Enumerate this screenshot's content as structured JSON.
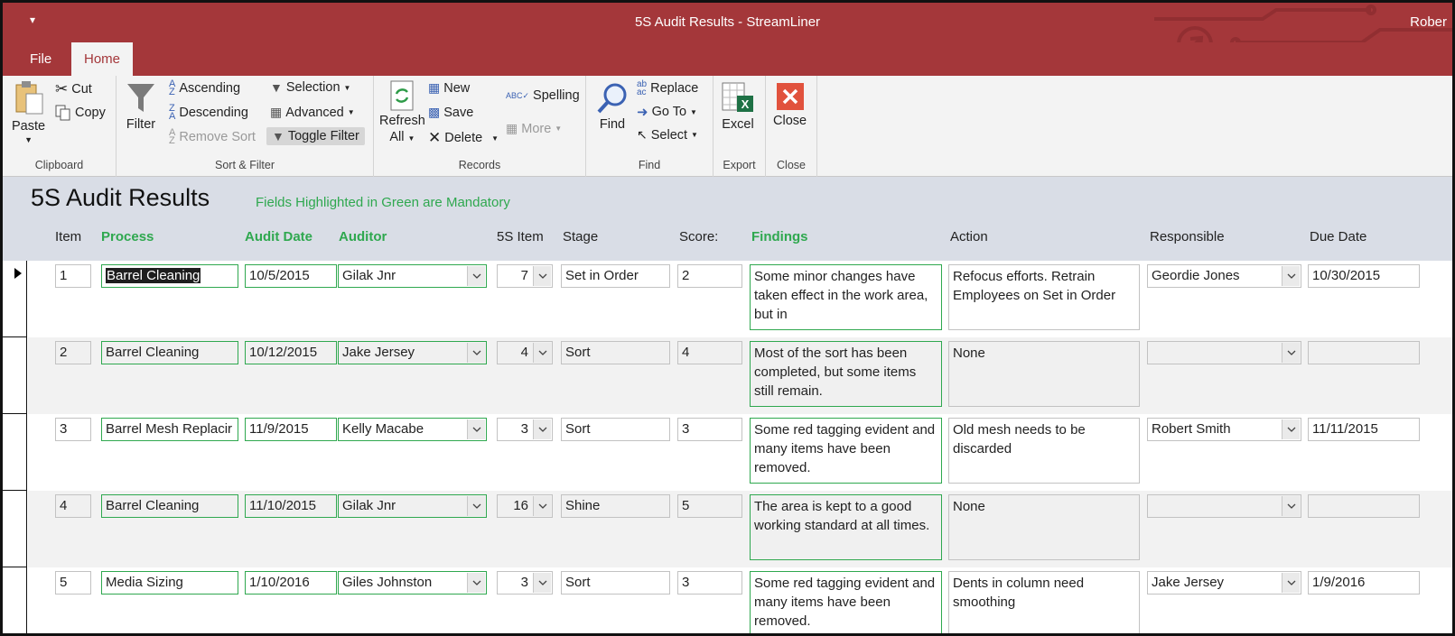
{
  "window": {
    "title": "5S Audit Results - StreamLiner",
    "user": "Rober",
    "qat_icon": "customize-qat-icon"
  },
  "tabs": [
    {
      "label": "File"
    },
    {
      "label": "Home"
    }
  ],
  "ribbon": {
    "clipboard": {
      "paste": "Paste",
      "cut": "Cut",
      "copy": "Copy",
      "label": "Clipboard"
    },
    "sort_filter": {
      "filter": "Filter",
      "ascending": "Ascending",
      "descending": "Descending",
      "remove_sort": "Remove Sort",
      "selection": "Selection",
      "advanced": "Advanced",
      "toggle_filter": "Toggle Filter",
      "label": "Sort & Filter"
    },
    "records": {
      "refresh": "Refresh",
      "refresh_sub": "All",
      "new": "New",
      "save": "Save",
      "delete": "Delete",
      "spelling": "Spelling",
      "more": "More",
      "label": "Records"
    },
    "find": {
      "find": "Find",
      "replace": "Replace",
      "goto": "Go To",
      "select": "Select",
      "label": "Find"
    },
    "export": {
      "excel": "Excel",
      "label": "Export"
    },
    "close": {
      "close": "Close",
      "label": "Close"
    }
  },
  "form": {
    "title": "5S Audit Results",
    "mandatory_note": "Fields Highlighted in Green are Mandatory",
    "headers": {
      "item": "Item",
      "process": "Process",
      "audit_date": "Audit Date",
      "auditor": "Auditor",
      "fives_item": "5S Item",
      "stage": "Stage",
      "score": "Score:",
      "findings": "Findings",
      "action": "Action",
      "responsible": "Responsible",
      "due_date": "Due Date"
    },
    "rows": [
      {
        "item": "1",
        "process": "Barrel Cleaning",
        "audit_date": "10/5/2015",
        "auditor": "Gilak Jnr",
        "fives_item": "7",
        "stage": "Set in Order",
        "score": "2",
        "findings": "Some minor changes have taken effect in the work area, but in",
        "action": "Refocus efforts. Retrain Employees on Set in Order",
        "responsible": "Geordie Jones",
        "due_date": "10/30/2015"
      },
      {
        "item": "2",
        "process": "Barrel Cleaning",
        "audit_date": "10/12/2015",
        "auditor": "Jake Jersey",
        "fives_item": "4",
        "stage": "Sort",
        "score": "4",
        "findings": "Most of the sort has been completed, but some items still remain.",
        "action": "None",
        "responsible": "",
        "due_date": ""
      },
      {
        "item": "3",
        "process": "Barrel Mesh Replacir",
        "audit_date": "11/9/2015",
        "auditor": "Kelly Macabe",
        "fives_item": "3",
        "stage": "Sort",
        "score": "3",
        "findings": "Some red tagging evident and many items have been removed.",
        "action": "Old mesh needs to be discarded",
        "responsible": "Robert Smith",
        "due_date": "11/11/2015"
      },
      {
        "item": "4",
        "process": "Barrel Cleaning",
        "audit_date": "11/10/2015",
        "auditor": "Gilak Jnr",
        "fives_item": "16",
        "stage": "Shine",
        "score": "5",
        "findings": "The area is kept to a good working standard at all times.",
        "action": "None",
        "responsible": "",
        "due_date": ""
      },
      {
        "item": "5",
        "process": "Media Sizing",
        "audit_date": "1/10/2016",
        "auditor": "Giles Johnston",
        "fives_item": "3",
        "stage": "Sort",
        "score": "3",
        "findings": "Some red tagging evident and many items have been removed.",
        "action": "Dents in column need smoothing",
        "responsible": "Jake Jersey",
        "due_date": "1/9/2016"
      }
    ]
  }
}
